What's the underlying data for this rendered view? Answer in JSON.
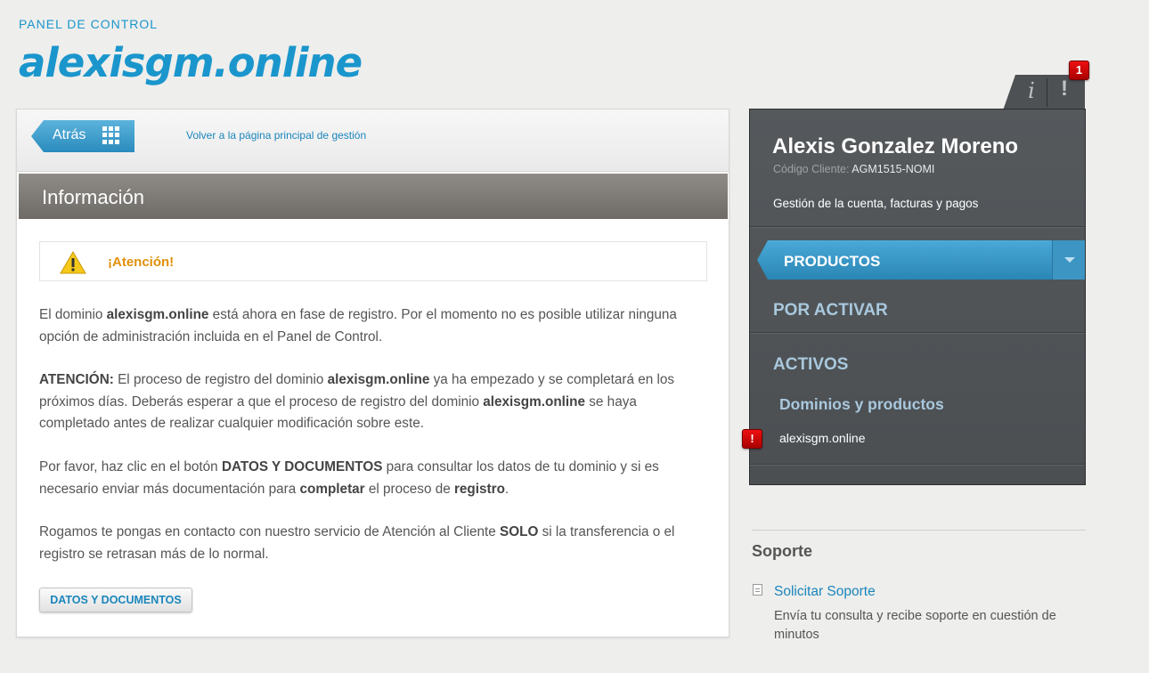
{
  "header": {
    "kicker": "PANEL DE CONTROL",
    "site": "alexisgm.online"
  },
  "toolbar": {
    "back_label": "Atrás",
    "home_link": "Volver a la página principal de gestión"
  },
  "info": {
    "title": "Información",
    "alert": "¡Atención!",
    "p1": [
      {
        "t": "El dominio "
      },
      {
        "t": "alexisgm.online",
        "b": true
      },
      {
        "t": " está ahora en fase de registro. Por el momento no es posible utilizar ninguna opción de administración incluida en el Panel de Control."
      }
    ],
    "p2": [
      {
        "t": "ATENCIÓN:",
        "b": true
      },
      {
        "t": " El proceso de registro del dominio "
      },
      {
        "t": "alexisgm.online",
        "b": true
      },
      {
        "t": " ya ha empezado y se completará en los próximos días. Deberás esperar a que el proceso de registro del dominio "
      },
      {
        "t": "alexisgm.online",
        "b": true
      },
      {
        "t": " se haya completado antes de realizar cualquier modificación sobre este."
      }
    ],
    "p3": [
      {
        "t": "Por favor, haz clic en el botón "
      },
      {
        "t": "DATOS Y DOCUMENTOS",
        "b": true
      },
      {
        "t": " para consultar los datos de tu dominio y si es necesario enviar más documentación para "
      },
      {
        "t": "completar",
        "b": true
      },
      {
        "t": " el proceso de "
      },
      {
        "t": "registro",
        "b": true
      },
      {
        "t": "."
      }
    ],
    "p4": [
      {
        "t": "Rogamos te pongas en contacto con nuestro servicio de Atención al Cliente "
      },
      {
        "t": "SOLO",
        "b": true
      },
      {
        "t": " si la transferencia o el registro se retrasan más de lo normal."
      }
    ],
    "button": "DATOS Y DOCUMENTOS"
  },
  "tabs": {
    "info_glyph": "i",
    "alert_glyph": "!",
    "alert_count": "1"
  },
  "account": {
    "name": "Alexis Gonzalez Moreno",
    "code_label": "Código Cliente:",
    "code": "AGM1515-NOMI",
    "manage": "Gestión de la cuenta, facturas y pagos",
    "productos": "PRODUCTOS",
    "por_activar": "POR ACTIVAR",
    "activos": "ACTIVOS",
    "dominios": "Dominios y productos",
    "domain": "alexisgm.online",
    "domain_badge": "!"
  },
  "support": {
    "title": "Soporte",
    "link": "Solicitar Soporte",
    "desc": "Envía tu consulta y recibe soporte en cuestión de minutos"
  },
  "colors": {
    "accent": "#1a96cc",
    "warning": "#e0900a",
    "badge": "#cc1111",
    "panel": "#4f5356"
  }
}
